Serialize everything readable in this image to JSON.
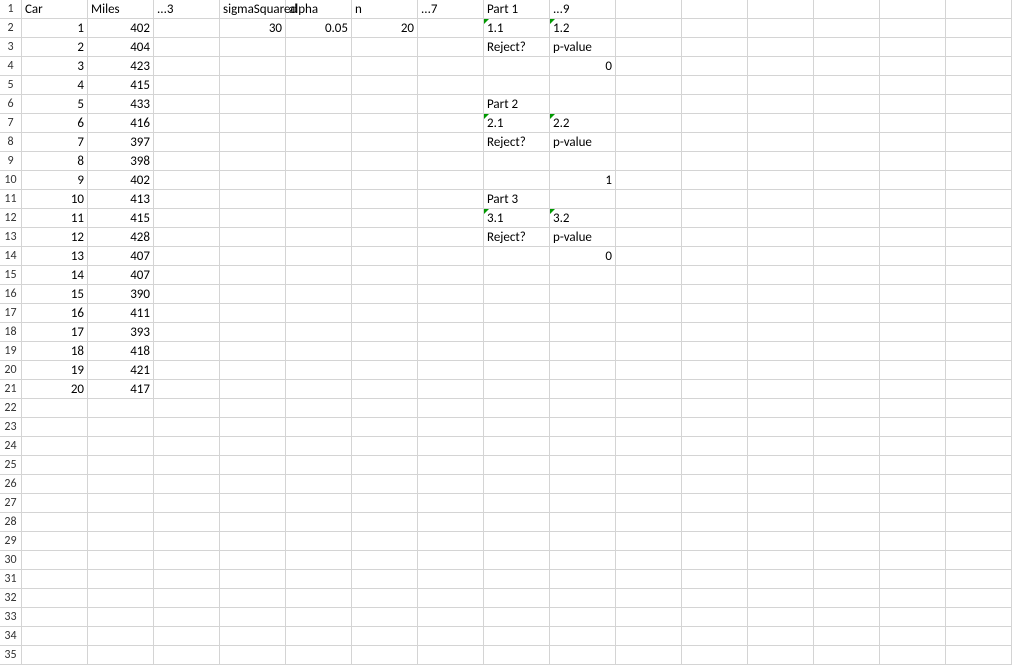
{
  "rows": 35,
  "cols": 15,
  "rowLabels": [
    "1",
    "2",
    "3",
    "4",
    "5",
    "6",
    "7",
    "8",
    "9",
    "10",
    "11",
    "12",
    "13",
    "14",
    "15",
    "16",
    "17",
    "18",
    "19",
    "20",
    "21",
    "22",
    "23",
    "24",
    "25",
    "26",
    "27",
    "28",
    "29",
    "30",
    "31",
    "32",
    "33",
    "34",
    "35"
  ],
  "cells": {
    "A1": {
      "text": "Car",
      "align": "left"
    },
    "B1": {
      "text": "Miles",
      "align": "left"
    },
    "C1": {
      "text": "...3",
      "align": "left"
    },
    "D1": {
      "text": "sigmaSquared",
      "align": "left",
      "overflow": true
    },
    "E1": {
      "text": "alpha",
      "align": "left"
    },
    "F1": {
      "text": "n",
      "align": "left"
    },
    "G1": {
      "text": "...7",
      "align": "left"
    },
    "H1": {
      "text": "Part 1",
      "align": "left"
    },
    "I1": {
      "text": "...9",
      "align": "left"
    },
    "A2": {
      "text": "1",
      "align": "right"
    },
    "B2": {
      "text": "402",
      "align": "right"
    },
    "D2": {
      "text": "30",
      "align": "right"
    },
    "E2": {
      "text": "0.05",
      "align": "right"
    },
    "F2": {
      "text": "20",
      "align": "right"
    },
    "H2": {
      "text": "1.1",
      "align": "left",
      "ind": true
    },
    "I2": {
      "text": "1.2",
      "align": "left",
      "ind": true
    },
    "A3": {
      "text": "2",
      "align": "right"
    },
    "B3": {
      "text": "404",
      "align": "right"
    },
    "H3": {
      "text": "Reject?",
      "align": "left"
    },
    "I3": {
      "text": "p-value",
      "align": "left"
    },
    "A4": {
      "text": "3",
      "align": "right"
    },
    "B4": {
      "text": "423",
      "align": "right"
    },
    "I4": {
      "text": "0",
      "align": "right"
    },
    "A5": {
      "text": "4",
      "align": "right"
    },
    "B5": {
      "text": "415",
      "align": "right"
    },
    "A6": {
      "text": "5",
      "align": "right"
    },
    "B6": {
      "text": "433",
      "align": "right"
    },
    "H6": {
      "text": "Part 2",
      "align": "left"
    },
    "A7": {
      "text": "6",
      "align": "right"
    },
    "B7": {
      "text": "416",
      "align": "right"
    },
    "H7": {
      "text": "2.1",
      "align": "left",
      "ind": true
    },
    "I7": {
      "text": "2.2",
      "align": "left",
      "ind": true
    },
    "A8": {
      "text": "7",
      "align": "right"
    },
    "B8": {
      "text": "397",
      "align": "right"
    },
    "H8": {
      "text": "Reject?",
      "align": "left"
    },
    "I8": {
      "text": "p-value",
      "align": "left"
    },
    "A9": {
      "text": "8",
      "align": "right"
    },
    "B9": {
      "text": "398",
      "align": "right"
    },
    "A10": {
      "text": "9",
      "align": "right"
    },
    "B10": {
      "text": "402",
      "align": "right"
    },
    "I10": {
      "text": "1",
      "align": "right"
    },
    "A11": {
      "text": "10",
      "align": "right"
    },
    "B11": {
      "text": "413",
      "align": "right"
    },
    "H11": {
      "text": "Part 3",
      "align": "left"
    },
    "A12": {
      "text": "11",
      "align": "right"
    },
    "B12": {
      "text": "415",
      "align": "right"
    },
    "H12": {
      "text": "3.1",
      "align": "left",
      "ind": true
    },
    "I12": {
      "text": "3.2",
      "align": "left",
      "ind": true
    },
    "A13": {
      "text": "12",
      "align": "right"
    },
    "B13": {
      "text": "428",
      "align": "right"
    },
    "H13": {
      "text": "Reject?",
      "align": "left"
    },
    "I13": {
      "text": "p-value",
      "align": "left"
    },
    "A14": {
      "text": "13",
      "align": "right"
    },
    "B14": {
      "text": "407",
      "align": "right"
    },
    "I14": {
      "text": "0",
      "align": "right"
    },
    "A15": {
      "text": "14",
      "align": "right"
    },
    "B15": {
      "text": "407",
      "align": "right"
    },
    "A16": {
      "text": "15",
      "align": "right"
    },
    "B16": {
      "text": "390",
      "align": "right"
    },
    "A17": {
      "text": "16",
      "align": "right"
    },
    "B17": {
      "text": "411",
      "align": "right"
    },
    "A18": {
      "text": "17",
      "align": "right"
    },
    "B18": {
      "text": "393",
      "align": "right"
    },
    "A19": {
      "text": "18",
      "align": "right"
    },
    "B19": {
      "text": "418",
      "align": "right"
    },
    "A20": {
      "text": "19",
      "align": "right"
    },
    "B20": {
      "text": "421",
      "align": "right"
    },
    "A21": {
      "text": "20",
      "align": "right"
    },
    "B21": {
      "text": "417",
      "align": "right"
    }
  }
}
